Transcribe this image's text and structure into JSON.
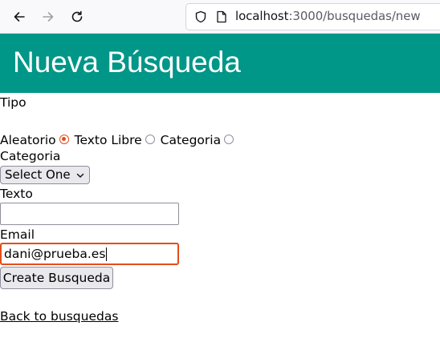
{
  "browser": {
    "url_host": "localhost",
    "url_rest": ":3000/busquedas/new",
    "icons": [
      "back-arrow-icon",
      "forward-arrow-icon",
      "reload-icon",
      "shield-icon",
      "page-icon"
    ]
  },
  "page": {
    "title": "Nueva Búsqueda",
    "header_color": "#009688"
  },
  "form": {
    "tipo_label": "Tipo",
    "radio_options": [
      {
        "label": "Aleatorio",
        "checked": true
      },
      {
        "label": "Texto Libre",
        "checked": false
      },
      {
        "label": "Categoria",
        "checked": false
      }
    ],
    "categoria_label": "Categoria",
    "categoria_selected": "Select One",
    "texto_label": "Texto",
    "texto_value": "",
    "email_label": "Email",
    "email_value": "dani@prueba.es",
    "submit_label": "Create Busqueda",
    "focus_color": "#e24d1a"
  },
  "back_link": "Back to busquedas"
}
